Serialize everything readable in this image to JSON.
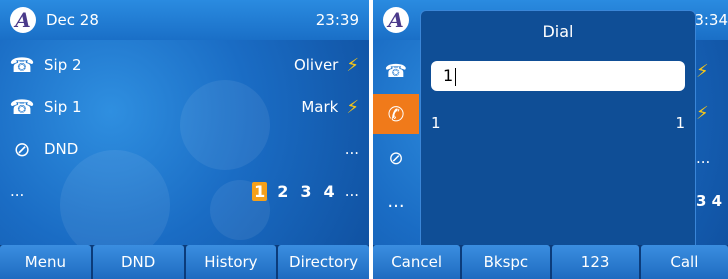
{
  "left": {
    "date": "Dec 28",
    "time": "23:39",
    "rows": [
      {
        "icon": "telephone-icon",
        "label": "Sip 2",
        "right": "Oliver"
      },
      {
        "icon": "telephone-status-icon",
        "label": "Sip 1",
        "right": "Mark"
      },
      {
        "icon": "block-icon",
        "label": "DND",
        "right": "..."
      }
    ],
    "ellipsis": "...",
    "pages": [
      "1",
      "2",
      "3",
      "4"
    ],
    "pages_trailing": "...",
    "softkeys": [
      "Menu",
      "DND",
      "History",
      "Directory"
    ]
  },
  "right": {
    "dialog_title": "Dial",
    "input_value": "1",
    "result_left": "1",
    "result_right": "1",
    "peek_time": "3:34",
    "peek_ellipsis": "...",
    "peek_pages": "3 4",
    "softkeys": [
      "Cancel",
      "Bkspc",
      "123",
      "Call"
    ]
  },
  "colors": {
    "accent": "#f5a01a",
    "call_tab": "#f07a1a",
    "flash": "#f5c518"
  }
}
